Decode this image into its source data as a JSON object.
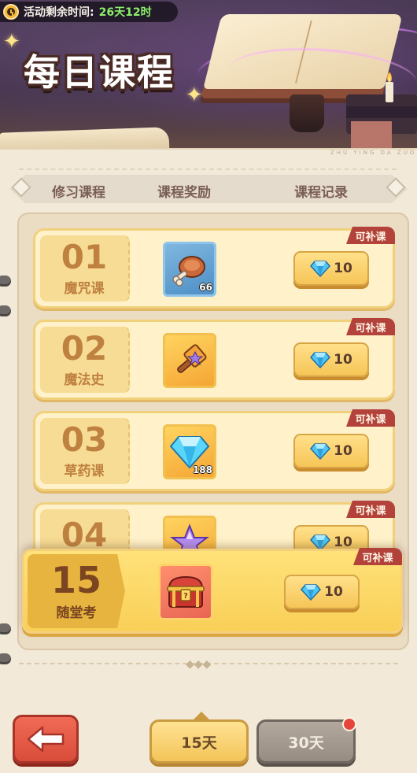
{
  "event_timer": {
    "label": "活动剩余时间:",
    "value": "26天12时"
  },
  "banner": {
    "title": "每日课程",
    "watermark": "ZHU YING DA ZUO"
  },
  "tabs": [
    {
      "label": "修习课程"
    },
    {
      "label": "课程奖励"
    },
    {
      "label": "课程记录"
    }
  ],
  "courses": [
    {
      "number": "01",
      "name": "魔咒课",
      "reward_icon": "roast-meat-icon",
      "reward_count": "66",
      "price": "10",
      "tag": "可补课"
    },
    {
      "number": "02",
      "name": "魔法史",
      "reward_icon": "magic-hammer-icon",
      "reward_count": "",
      "price": "10",
      "tag": "可补课"
    },
    {
      "number": "03",
      "name": "草药课",
      "reward_icon": "diamond-icon",
      "reward_count": "188",
      "price": "10",
      "tag": "可补课"
    },
    {
      "number": "04",
      "name": "",
      "reward_icon": "purple-crystal-icon",
      "reward_count": "",
      "price": "10",
      "tag": "可补课"
    }
  ],
  "exam": {
    "number": "15",
    "name": "随堂考",
    "reward_icon": "treasure-chest-icon",
    "price": "10",
    "tag": "可补课"
  },
  "bottom_bar": {
    "back_icon": "back-arrow-icon",
    "day_tabs": [
      {
        "label": "15天",
        "selected": true
      },
      {
        "label": "30天",
        "selected": false,
        "has_notification": true
      }
    ]
  },
  "colors": {
    "accent_gold": "#f6c557",
    "tag_red": "#b2423a",
    "back_red": "#d84c3a",
    "timer_green": "#8cf06a"
  }
}
